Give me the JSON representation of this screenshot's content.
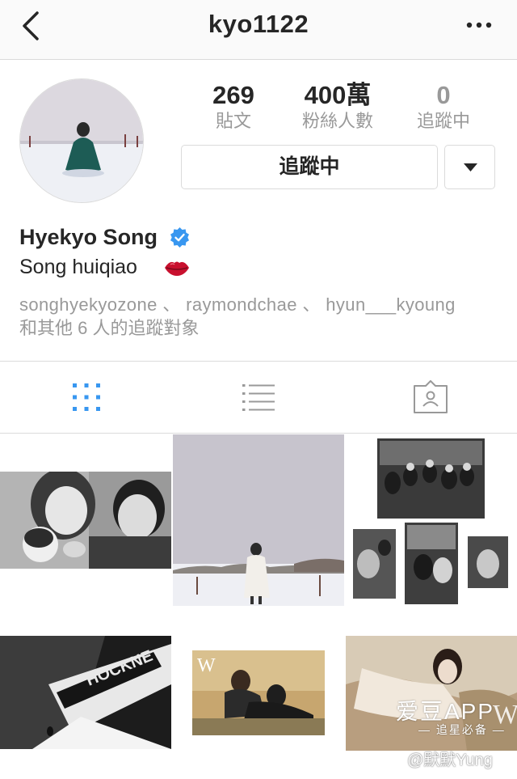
{
  "navbar": {
    "title": "kyo1122",
    "back_icon": "chevron-left-icon",
    "more_icon": "more-horizontal-icon"
  },
  "profile": {
    "stats": [
      {
        "value": "269",
        "label": "貼文"
      },
      {
        "value": "400萬",
        "label": "粉絲人數"
      },
      {
        "value": "0",
        "label": "追蹤中"
      }
    ],
    "follow_button": "追蹤中",
    "display_name": "Hyekyo Song",
    "bio": "Song huiqiao",
    "followed_by_names": "songhyekyozone 、 raymondchae 、 hyun___kyoung",
    "followed_by_suffix": "和其他 6 人的追蹤對象"
  },
  "tabs": [
    "grid-icon",
    "list-icon",
    "tagged-icon"
  ],
  "overlay": {
    "app_name": "爱豆APP",
    "app_slogan": "— 追星必备 —",
    "watermark": "@默默Yung"
  },
  "colors": {
    "accent": "#3897f0",
    "border": "#dbdbdb",
    "muted": "#999999"
  }
}
